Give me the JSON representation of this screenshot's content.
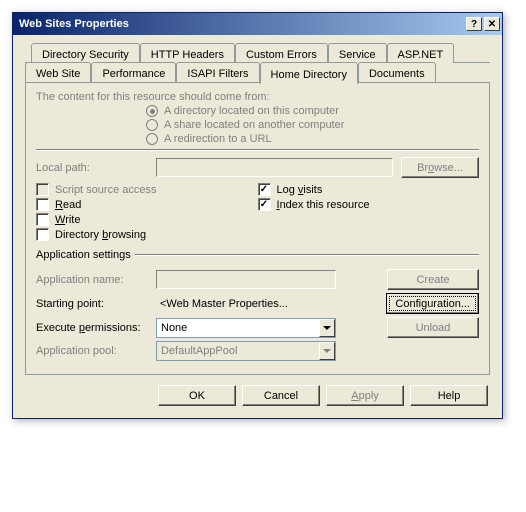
{
  "window": {
    "title": "Web Sites Properties"
  },
  "tabs_back": [
    "Directory Security",
    "HTTP Headers",
    "Custom Errors",
    "Service",
    "ASP.NET"
  ],
  "tabs_front": [
    "Web Site",
    "Performance",
    "ISAPI Filters",
    "Home Directory",
    "Documents"
  ],
  "content_from_label": "The content for this resource should come from:",
  "radios": [
    "A directory located on this computer",
    "A share located on another computer",
    "A redirection to a URL"
  ],
  "local_path_label": "Local path:",
  "browse_label": "Browse...",
  "checks_left": [
    "Script source access",
    "Read",
    "Write",
    "Directory browsing"
  ],
  "checks_left_u": [
    "",
    "R",
    "W",
    "b"
  ],
  "checks_right": [
    "Log visits",
    "Index this resource"
  ],
  "checks_right_u": [
    "v",
    "I"
  ],
  "app_settings_label": "Application settings",
  "app_name_label": "Application name:",
  "create_label": "Create",
  "starting_point_label": "Starting point:",
  "starting_point_value": "<Web Master Properties...",
  "configuration_label": "Configuration...",
  "execute_label": "Execute permissions:",
  "execute_value": "None",
  "unload_label": "Unload",
  "pool_label": "Application pool:",
  "pool_value": "DefaultAppPool",
  "footer": {
    "ok": "OK",
    "cancel": "Cancel",
    "apply": "Apply",
    "help": "Help"
  }
}
